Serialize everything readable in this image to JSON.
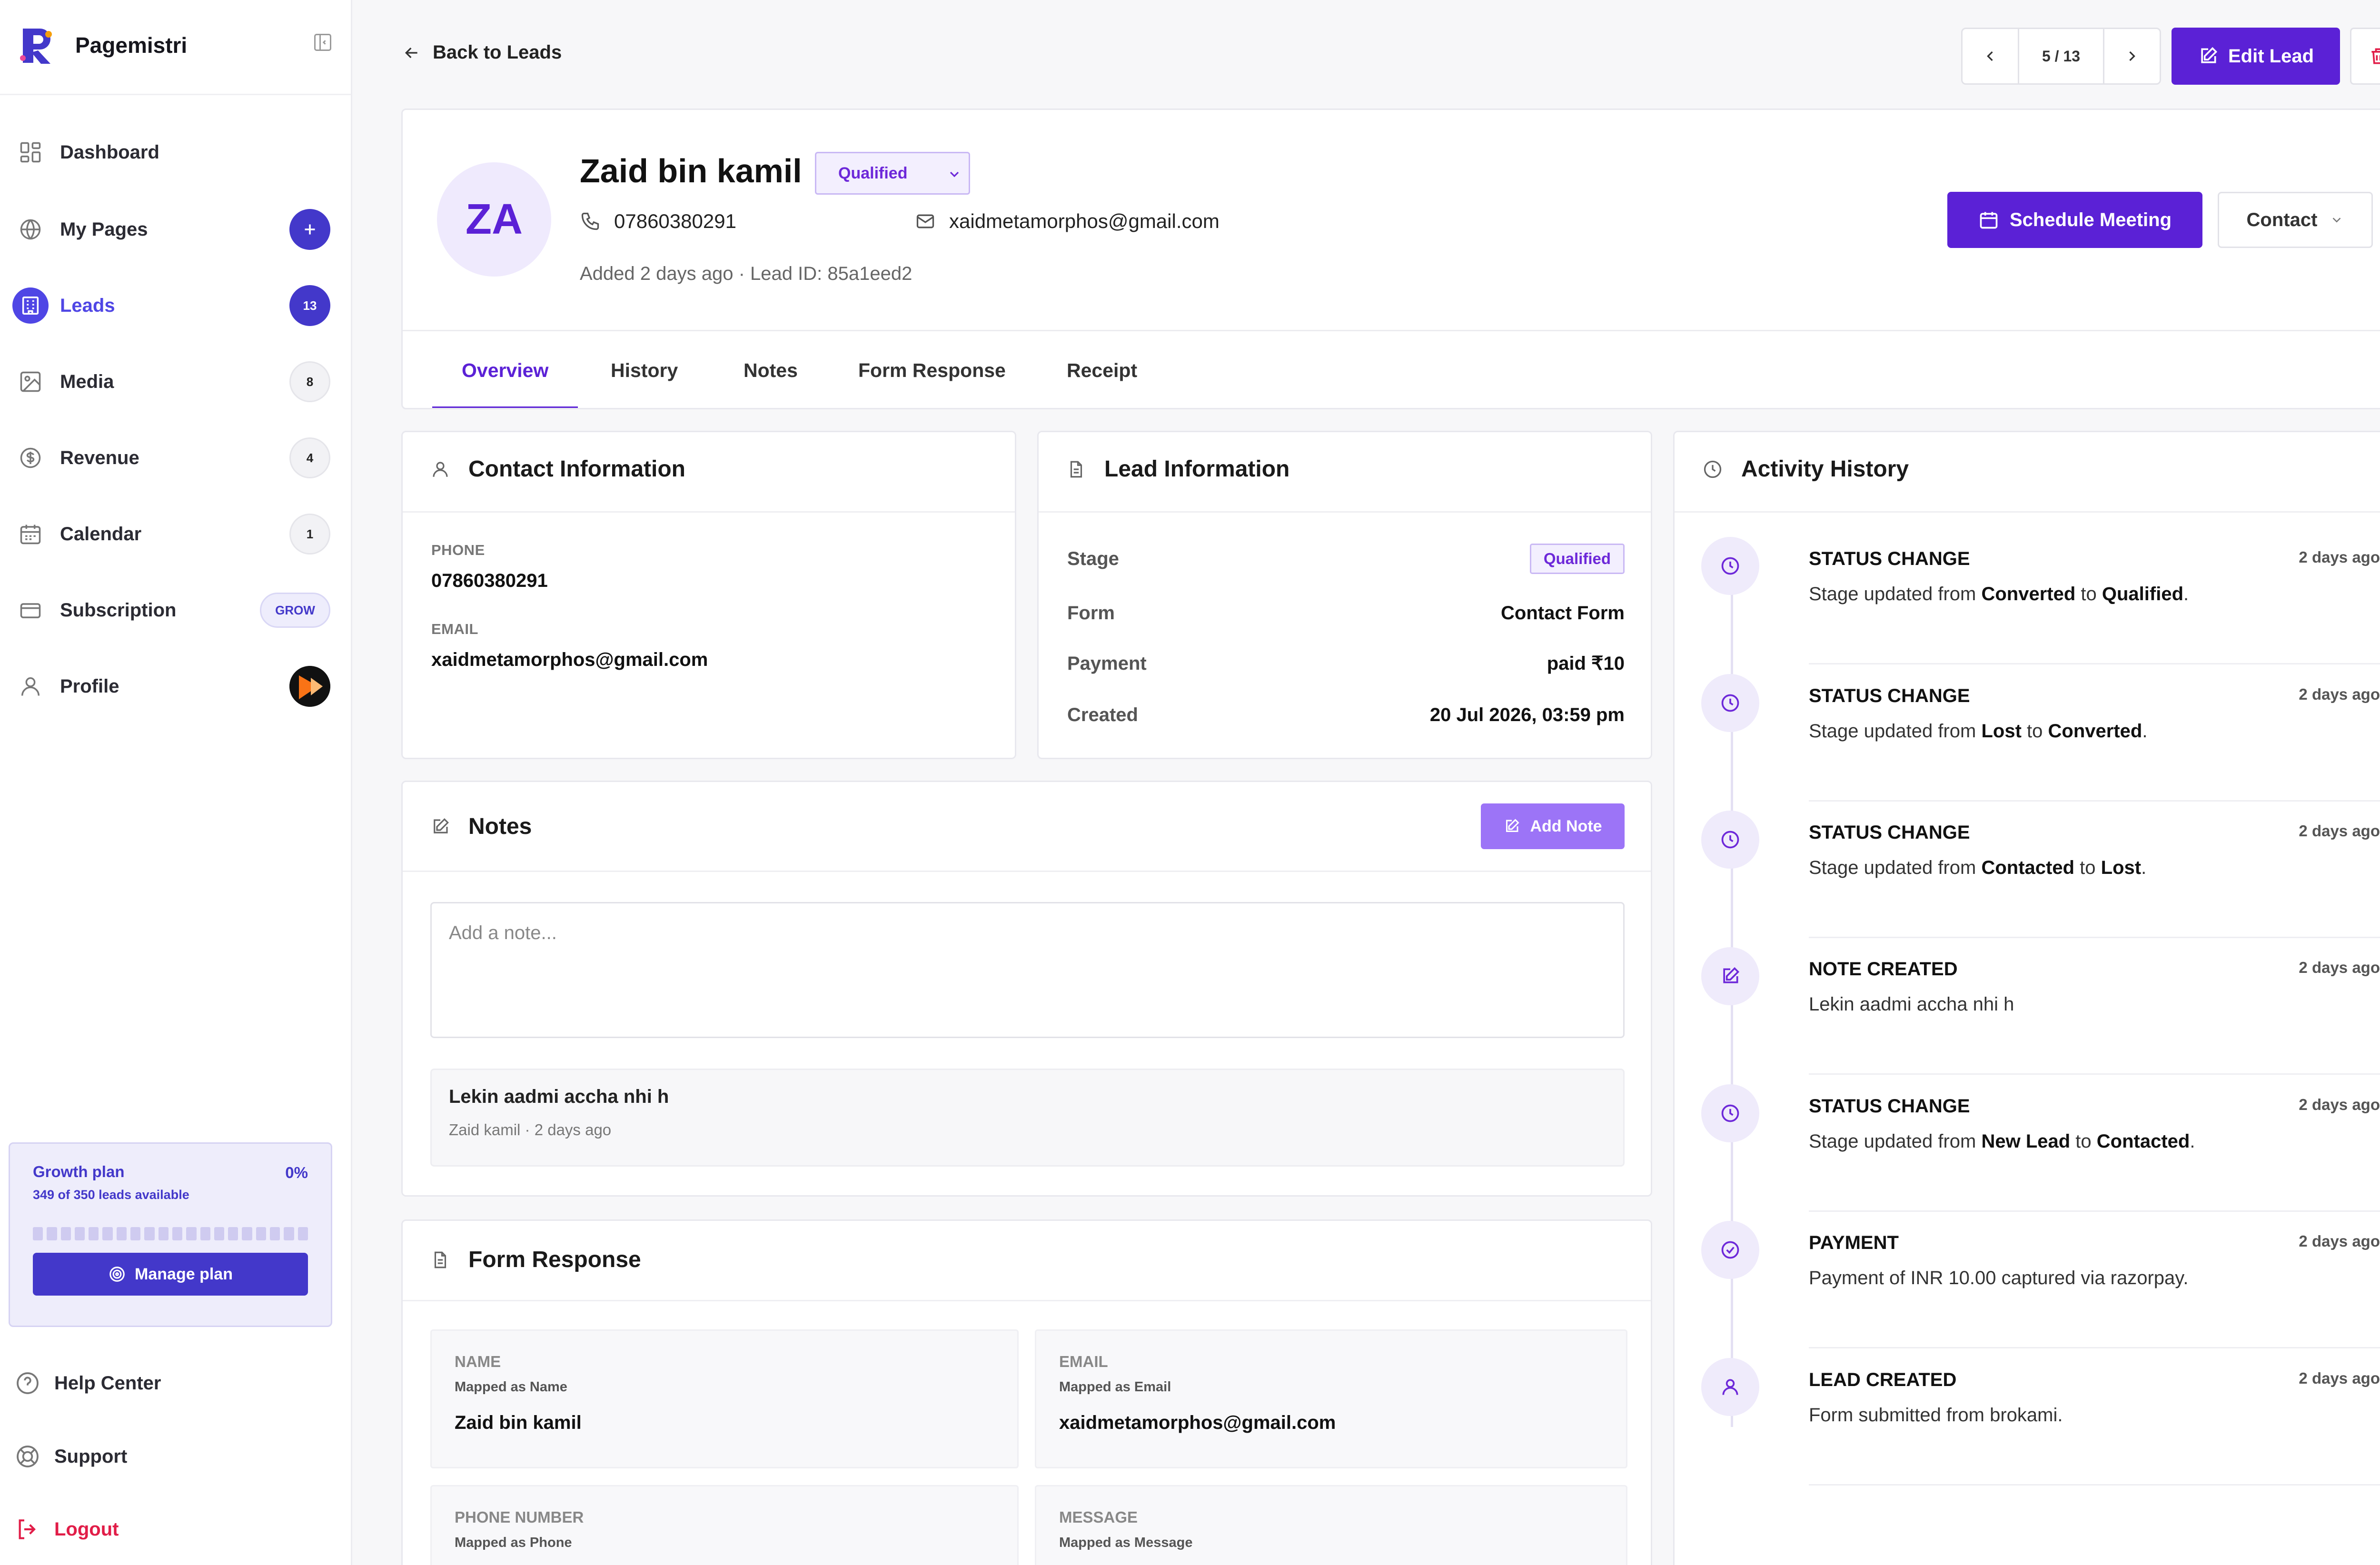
{
  "app": {
    "name": "Pagemistri"
  },
  "sidebar": {
    "items": [
      {
        "label": "Dashboard",
        "icon": "grid-icon"
      },
      {
        "label": "My Pages",
        "icon": "globe-icon",
        "action": "+"
      },
      {
        "label": "Leads",
        "icon": "building-icon",
        "badge": "13",
        "active": true
      },
      {
        "label": "Media",
        "icon": "image-icon",
        "badge": "8"
      },
      {
        "label": "Revenue",
        "icon": "dollar-icon",
        "badge": "4"
      },
      {
        "label": "Calendar",
        "icon": "calendar-icon",
        "badge": "1"
      },
      {
        "label": "Subscription",
        "icon": "card-icon",
        "badge": "GROW"
      },
      {
        "label": "Profile",
        "icon": "user-icon"
      }
    ],
    "plan": {
      "title": "Growth plan",
      "percent": "0%",
      "subtitle": "349 of 350 leads available",
      "usage_fraction": 0.003,
      "button": "Manage plan"
    },
    "bottom": [
      {
        "label": "Help Center",
        "icon": "help-icon"
      },
      {
        "label": "Support",
        "icon": "lifebuoy-icon"
      },
      {
        "label": "Logout",
        "icon": "logout-icon"
      }
    ]
  },
  "topbar": {
    "back_label": "Back to Leads",
    "pager": "5 / 13",
    "edit_label": "Edit Lead"
  },
  "lead": {
    "initials": "ZA",
    "name": "Zaid bin kamil",
    "status": "Qualified",
    "phone": "07860380291",
    "email": "xaidmetamorphos@gmail.com",
    "meta": "Added 2 days ago · Lead ID: 85a1eed2",
    "schedule_label": "Schedule Meeting",
    "contact_label": "Contact"
  },
  "tabs": [
    "Overview",
    "History",
    "Notes",
    "Form Response",
    "Receipt"
  ],
  "contact_info": {
    "title": "Contact Information",
    "phone_label": "PHONE",
    "phone": "07860380291",
    "email_label": "EMAIL",
    "email": "xaidmetamorphos@gmail.com"
  },
  "lead_info": {
    "title": "Lead Information",
    "rows": [
      {
        "key": "Stage",
        "value": "Qualified"
      },
      {
        "key": "Form",
        "value": "Contact Form"
      },
      {
        "key": "Payment",
        "value": "paid ₹10"
      },
      {
        "key": "Created",
        "value": "20 Jul 2026, 03:59 pm"
      }
    ]
  },
  "notes": {
    "title": "Notes",
    "add_label": "Add Note",
    "placeholder": "Add a note...",
    "items": [
      {
        "text": "Lekin aadmi accha nhi h",
        "meta": "Zaid kamil · 2 days ago"
      }
    ]
  },
  "form_response": {
    "title": "Form Response",
    "fields": [
      {
        "label": "NAME",
        "mapped": "Mapped as Name",
        "value": "Zaid bin kamil"
      },
      {
        "label": "EMAIL",
        "mapped": "Mapped as Email",
        "value": "xaidmetamorphos@gmail.com"
      },
      {
        "label": "PHONE NUMBER",
        "mapped": "Mapped as Phone",
        "value": ""
      },
      {
        "label": "MESSAGE",
        "mapped": "Mapped as Message",
        "value": ""
      }
    ]
  },
  "activity": {
    "title": "Activity History",
    "items": [
      {
        "title": "STATUS CHANGE",
        "time": "2 days ago",
        "pre": "Stage updated from ",
        "b1": "Converted",
        "mid": " to ",
        "b2": "Qualified",
        "post": ".",
        "icon": "clock-icon"
      },
      {
        "title": "STATUS CHANGE",
        "time": "2 days ago",
        "pre": "Stage updated from ",
        "b1": "Lost",
        "mid": " to ",
        "b2": "Converted",
        "post": ".",
        "icon": "clock-icon"
      },
      {
        "title": "STATUS CHANGE",
        "time": "2 days ago",
        "pre": "Stage updated from ",
        "b1": "Contacted",
        "mid": " to ",
        "b2": "Lost",
        "post": ".",
        "icon": "clock-icon"
      },
      {
        "title": "NOTE CREATED",
        "time": "2 days ago",
        "pre": "Lekin aadmi accha nhi h",
        "b1": "",
        "mid": "",
        "b2": "",
        "post": "",
        "icon": "note-icon"
      },
      {
        "title": "STATUS CHANGE",
        "time": "2 days ago",
        "pre": "Stage updated from ",
        "b1": "New Lead",
        "mid": " to ",
        "b2": "Contacted",
        "post": ".",
        "icon": "clock-icon"
      },
      {
        "title": "PAYMENT",
        "time": "2 days ago",
        "pre": "Payment of INR 10.00 captured via razorpay.",
        "b1": "",
        "mid": "",
        "b2": "",
        "post": "",
        "icon": "check-circle-icon"
      },
      {
        "title": "LEAD CREATED",
        "time": "2 days ago",
        "pre": "Form submitted from brokami.",
        "b1": "",
        "mid": "",
        "b2": "",
        "post": "",
        "icon": "user-icon"
      }
    ]
  },
  "colors": {
    "accent": "#5B21D6",
    "sidebar_accent": "#4338CA",
    "danger": "#E11D48"
  }
}
